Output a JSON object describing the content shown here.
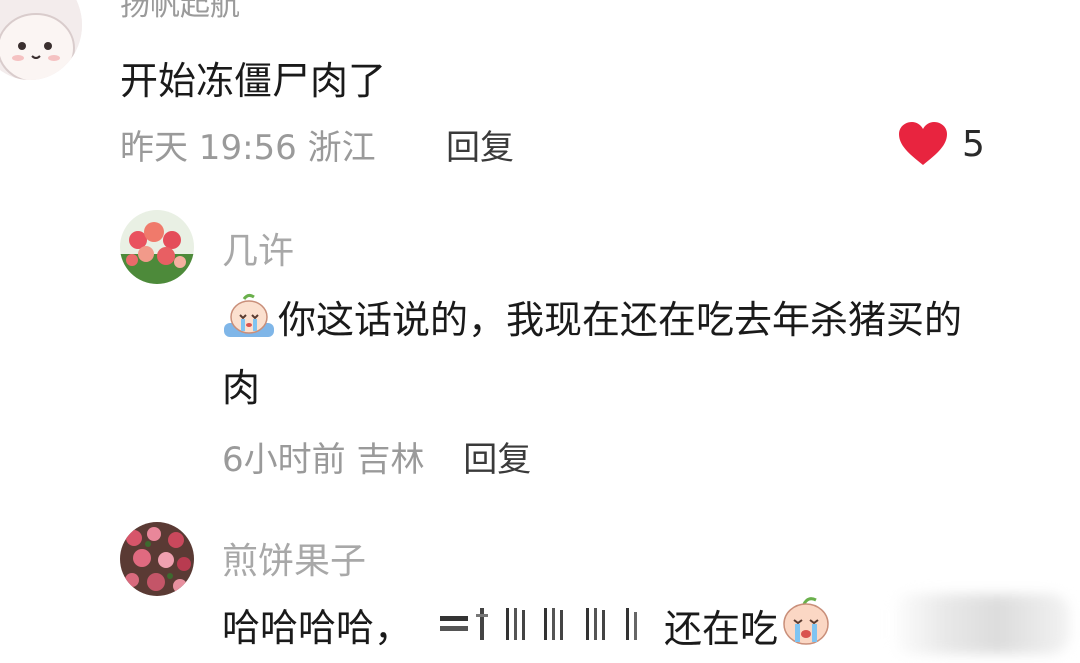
{
  "comment": {
    "username": "扬帆起航",
    "text": "开始冻僵尸肉了",
    "time": "昨天 19:56",
    "location": "浙江",
    "reply_label": "回复",
    "like_count": "5",
    "like_color": "#e8243f"
  },
  "replies": [
    {
      "username": "几许",
      "text_line1": "你这话说的，我现在还在吃去年杀猪买的",
      "text_line2": "肉",
      "time": "6小时前",
      "location": "吉林",
      "reply_label": "回复",
      "emoji": "crying-emoji"
    },
    {
      "username": "煎饼果子",
      "text_prefix": "哈哈哈哈，",
      "text_suffix": "还在吃",
      "emoji": "crying-emoji"
    }
  ]
}
